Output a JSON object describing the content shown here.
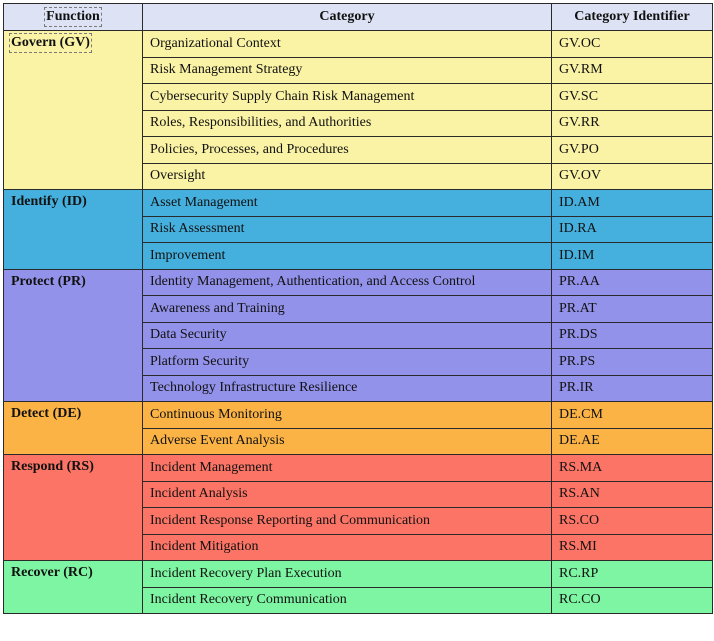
{
  "header": {
    "function": "Function",
    "category": "Category",
    "identifier": "Category Identifier"
  },
  "colors": {
    "header": "#dde3f4",
    "govern": "#faf3a5",
    "identify": "#45b0de",
    "protect": "#9392ea",
    "detect": "#fbb346",
    "respond": "#fb7466",
    "recover": "#7ef5a2"
  },
  "functions": [
    {
      "name": "Govern (GV)",
      "color": "#faf3a5",
      "categories": [
        {
          "category": "Organizational Context",
          "id": "GV.OC"
        },
        {
          "category": "Risk Management Strategy",
          "id": "GV.RM"
        },
        {
          "category": "Cybersecurity Supply Chain Risk Management",
          "id": "GV.SC"
        },
        {
          "category": "Roles, Responsibilities, and Authorities",
          "id": "GV.RR"
        },
        {
          "category": "Policies, Processes, and Procedures",
          "id": "GV.PO"
        },
        {
          "category": "Oversight",
          "id": "GV.OV"
        }
      ]
    },
    {
      "name": "Identify (ID)",
      "color": "#45b0de",
      "categories": [
        {
          "category": "Asset Management",
          "id": "ID.AM"
        },
        {
          "category": "Risk Assessment",
          "id": "ID.RA"
        },
        {
          "category": "Improvement",
          "id": "ID.IM"
        }
      ]
    },
    {
      "name": "Protect (PR)",
      "color": "#9392ea",
      "categories": [
        {
          "category": "Identity Management, Authentication, and Access Control",
          "id": "PR.AA"
        },
        {
          "category": "Awareness and Training",
          "id": "PR.AT"
        },
        {
          "category": "Data Security",
          "id": "PR.DS"
        },
        {
          "category": "Platform Security",
          "id": "PR.PS"
        },
        {
          "category": "Technology Infrastructure Resilience",
          "id": "PR.IR"
        }
      ]
    },
    {
      "name": "Detect (DE)",
      "color": "#fbb346",
      "categories": [
        {
          "category": "Continuous Monitoring",
          "id": "DE.CM"
        },
        {
          "category": "Adverse Event Analysis",
          "id": "DE.AE"
        }
      ]
    },
    {
      "name": "Respond (RS)",
      "color": "#fb7466",
      "categories": [
        {
          "category": "Incident Management",
          "id": "RS.MA"
        },
        {
          "category": "Incident Analysis",
          "id": "RS.AN"
        },
        {
          "category": "Incident Response Reporting and Communication",
          "id": "RS.CO"
        },
        {
          "category": "Incident Mitigation",
          "id": "RS.MI"
        }
      ]
    },
    {
      "name": "Recover (RC)",
      "color": "#7ef5a2",
      "categories": [
        {
          "category": "Incident Recovery Plan Execution",
          "id": "RC.RP"
        },
        {
          "category": "Incident Recovery Communication",
          "id": "RC.CO"
        }
      ]
    }
  ]
}
